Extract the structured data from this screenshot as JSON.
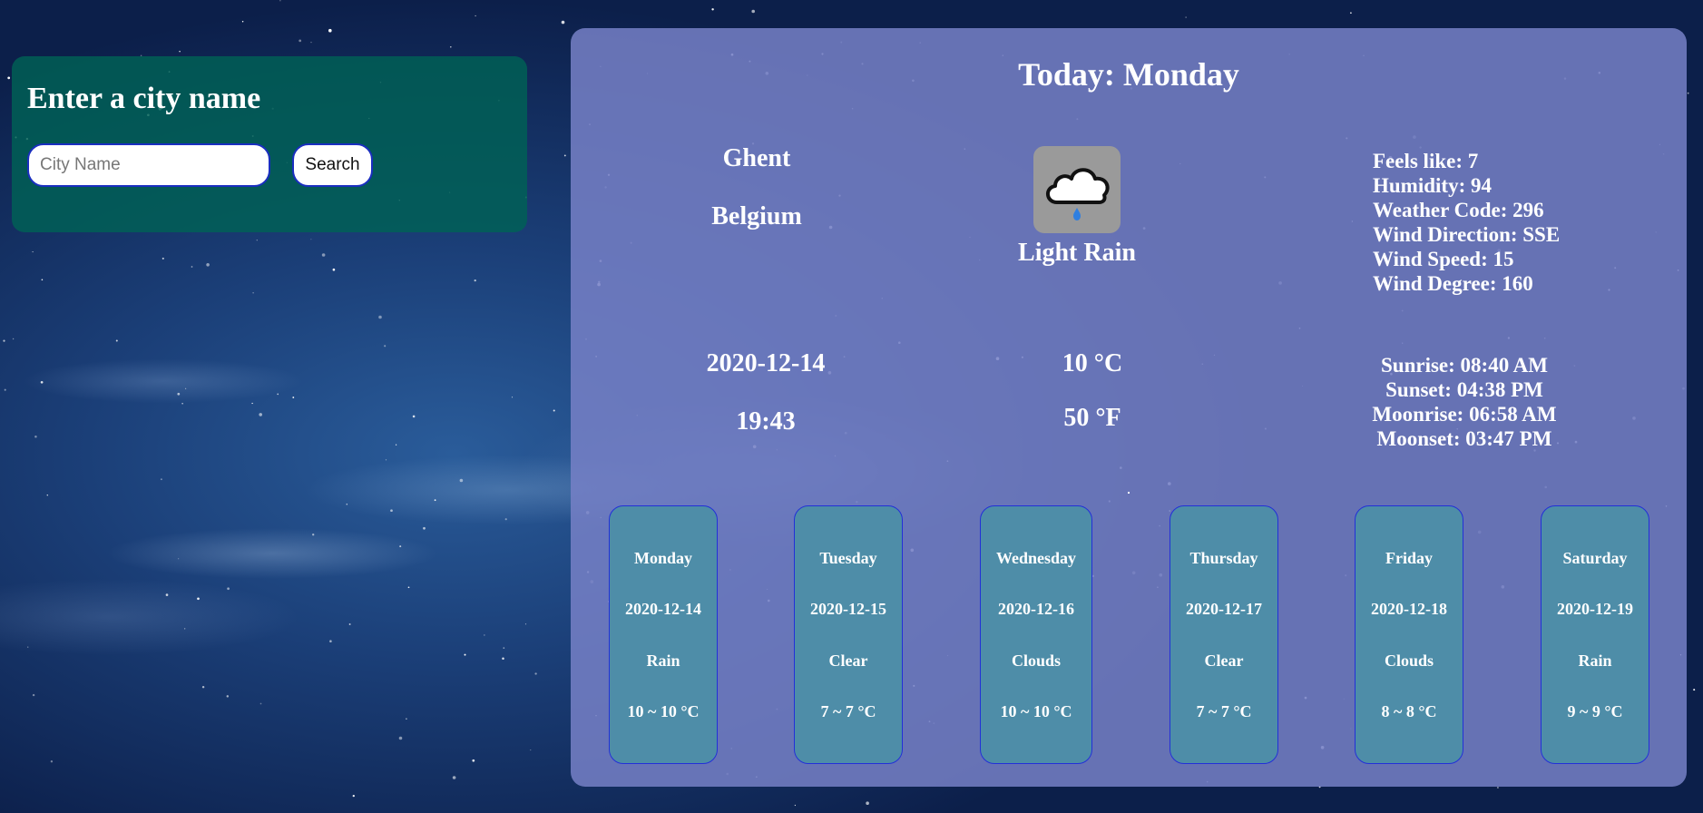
{
  "search": {
    "title": "Enter a city name",
    "input_value": "",
    "placeholder": "City Name",
    "button_label": "Search"
  },
  "today": {
    "title": "Today: Monday",
    "city": "Ghent",
    "country": "Belgium",
    "icon": "light-rain-icon",
    "condition": "Light Rain",
    "details": {
      "feels_like": "Feels like: 7",
      "humidity": "Humidity: 94",
      "weather_code": "Weather Code: 296",
      "wind_direction": "Wind Direction: SSE",
      "wind_speed": "Wind Speed: 15",
      "wind_degree": "Wind Degree: 160"
    },
    "date": "2020-12-14",
    "time": "19:43",
    "temp_c": "10 °C",
    "temp_f": "50 °F",
    "astro": {
      "sunrise": "Sunrise: 08:40 AM",
      "sunset": "Sunset: 04:38 PM",
      "moonrise": "Moonrise: 06:58 AM",
      "moonset": "Moonset: 03:47 PM"
    }
  },
  "forecast": [
    {
      "day": "Monday",
      "date": "2020-12-14",
      "condition": "Rain",
      "temp": "10 ~ 10 °C"
    },
    {
      "day": "Tuesday",
      "date": "2020-12-15",
      "condition": "Clear",
      "temp": "7 ~ 7 °C"
    },
    {
      "day": "Wednesday",
      "date": "2020-12-16",
      "condition": "Clouds",
      "temp": "10 ~ 10 °C"
    },
    {
      "day": "Thursday",
      "date": "2020-12-17",
      "condition": "Clear",
      "temp": "7 ~ 7 °C"
    },
    {
      "day": "Friday",
      "date": "2020-12-18",
      "condition": "Clouds",
      "temp": "8 ~ 8 °C"
    },
    {
      "day": "Saturday",
      "date": "2020-12-19",
      "condition": "Rain",
      "temp": "9 ~ 9 °C"
    }
  ],
  "colors": {
    "search_panel": "#006256",
    "weather_panel": "#7680c6",
    "card": "#4e8da8",
    "card_border": "#2230d8",
    "input_border": "#1a2ec0"
  }
}
